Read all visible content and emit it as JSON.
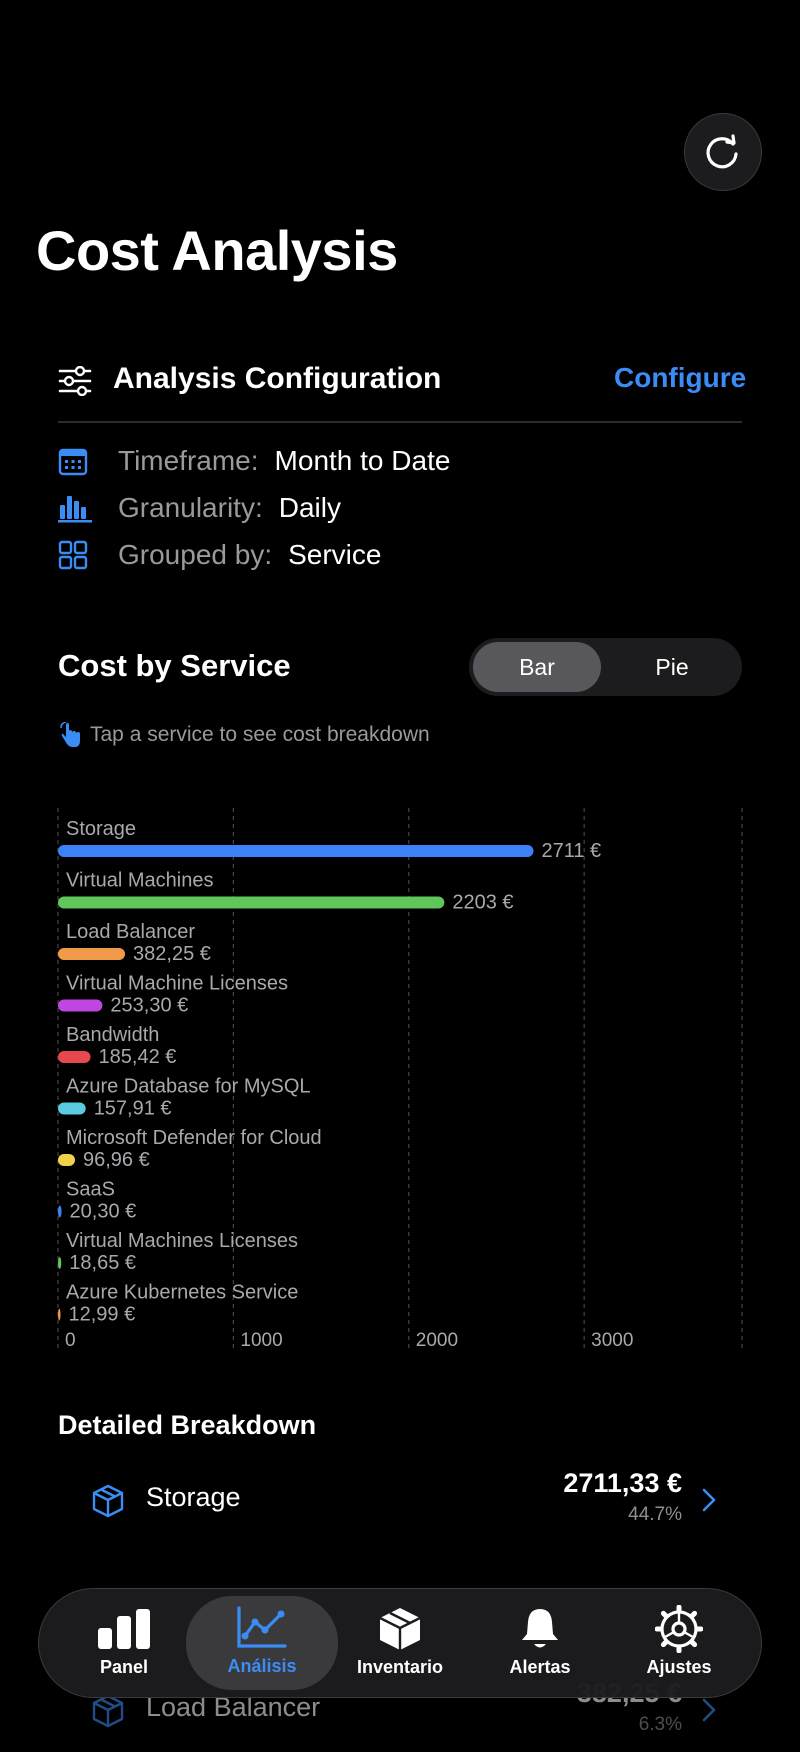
{
  "page": {
    "title": "Cost Analysis"
  },
  "config": {
    "title": "Analysis Configuration",
    "configure_label": "Configure",
    "rows": [
      {
        "icon": "calendar-icon",
        "label": "Timeframe:",
        "value": "Month to Date"
      },
      {
        "icon": "bar-chart-icon",
        "label": "Granularity:",
        "value": "Daily"
      },
      {
        "icon": "grid-icon",
        "label": "Grouped by:",
        "value": "Service"
      }
    ]
  },
  "section": {
    "title": "Cost by Service",
    "toggle": {
      "bar": "Bar",
      "pie": "Pie",
      "selected": "Bar"
    },
    "hint": "Tap a service to see cost breakdown"
  },
  "chart_data": {
    "type": "bar",
    "orientation": "horizontal",
    "categories": [
      "Storage",
      "Virtual Machines",
      "Load Balancer",
      "Virtual Machine Licenses",
      "Bandwidth",
      "Azure Database for MySQL",
      "Microsoft Defender for Cloud",
      "SaaS",
      "Virtual Machines Licenses",
      "Azure Kubernetes Service"
    ],
    "values": [
      2711,
      2203,
      382.25,
      253.3,
      185.42,
      157.91,
      96.96,
      20.3,
      18.65,
      12.99
    ],
    "value_labels": [
      "2711 €",
      "2203 €",
      "382,25 €",
      "253,30 €",
      "185,42 €",
      "157,91 €",
      "96,96 €",
      "20,30 €",
      "18,65 €",
      "12,99 €"
    ],
    "colors": [
      "#3b82f6",
      "#5ec65a",
      "#f09a4a",
      "#c046e0",
      "#e5484d",
      "#5bcce0",
      "#f2d24a",
      "#3b82f6",
      "#5ec65a",
      "#f09a4a"
    ],
    "xlim": [
      0,
      3900
    ],
    "xticks": [
      0,
      1000,
      2000,
      3000
    ],
    "xtick_labels": [
      "0",
      "1000",
      "2000",
      "3000"
    ],
    "grid": true
  },
  "detail": {
    "title": "Detailed Breakdown",
    "rows": [
      {
        "name": "Storage",
        "amount": "2711,33 €",
        "percent": "44.7%",
        "icon": "cube-icon"
      },
      {
        "name": "Load Balancer",
        "amount": "382,25 €",
        "percent": "6.3%",
        "icon": "cube-icon"
      }
    ]
  },
  "tabbar": {
    "tabs": [
      {
        "label": "Panel",
        "icon": "chart-bars-icon"
      },
      {
        "label": "Análisis",
        "icon": "line-chart-icon",
        "active": true
      },
      {
        "label": "Inventario",
        "icon": "box-icon"
      },
      {
        "label": "Alertas",
        "icon": "bell-icon"
      },
      {
        "label": "Ajustes",
        "icon": "gear-icon"
      }
    ]
  },
  "colors": {
    "accent": "#3b8cf5",
    "background": "#000000"
  }
}
